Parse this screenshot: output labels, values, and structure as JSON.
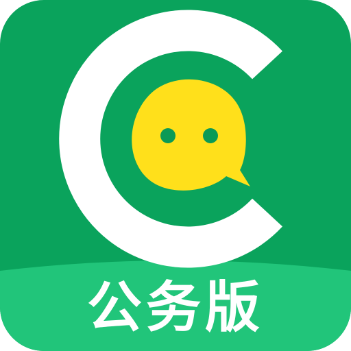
{
  "app_icon": {
    "label": "公务版",
    "logo_letter": "C",
    "icon_name": "chat-bubble-smiley-icon",
    "colors": {
      "background": "#0aa35c",
      "band": "#21c57a",
      "logo_ring": "#ffffff",
      "bubble": "#ffe01b",
      "eyes": "#0a9a56"
    }
  }
}
